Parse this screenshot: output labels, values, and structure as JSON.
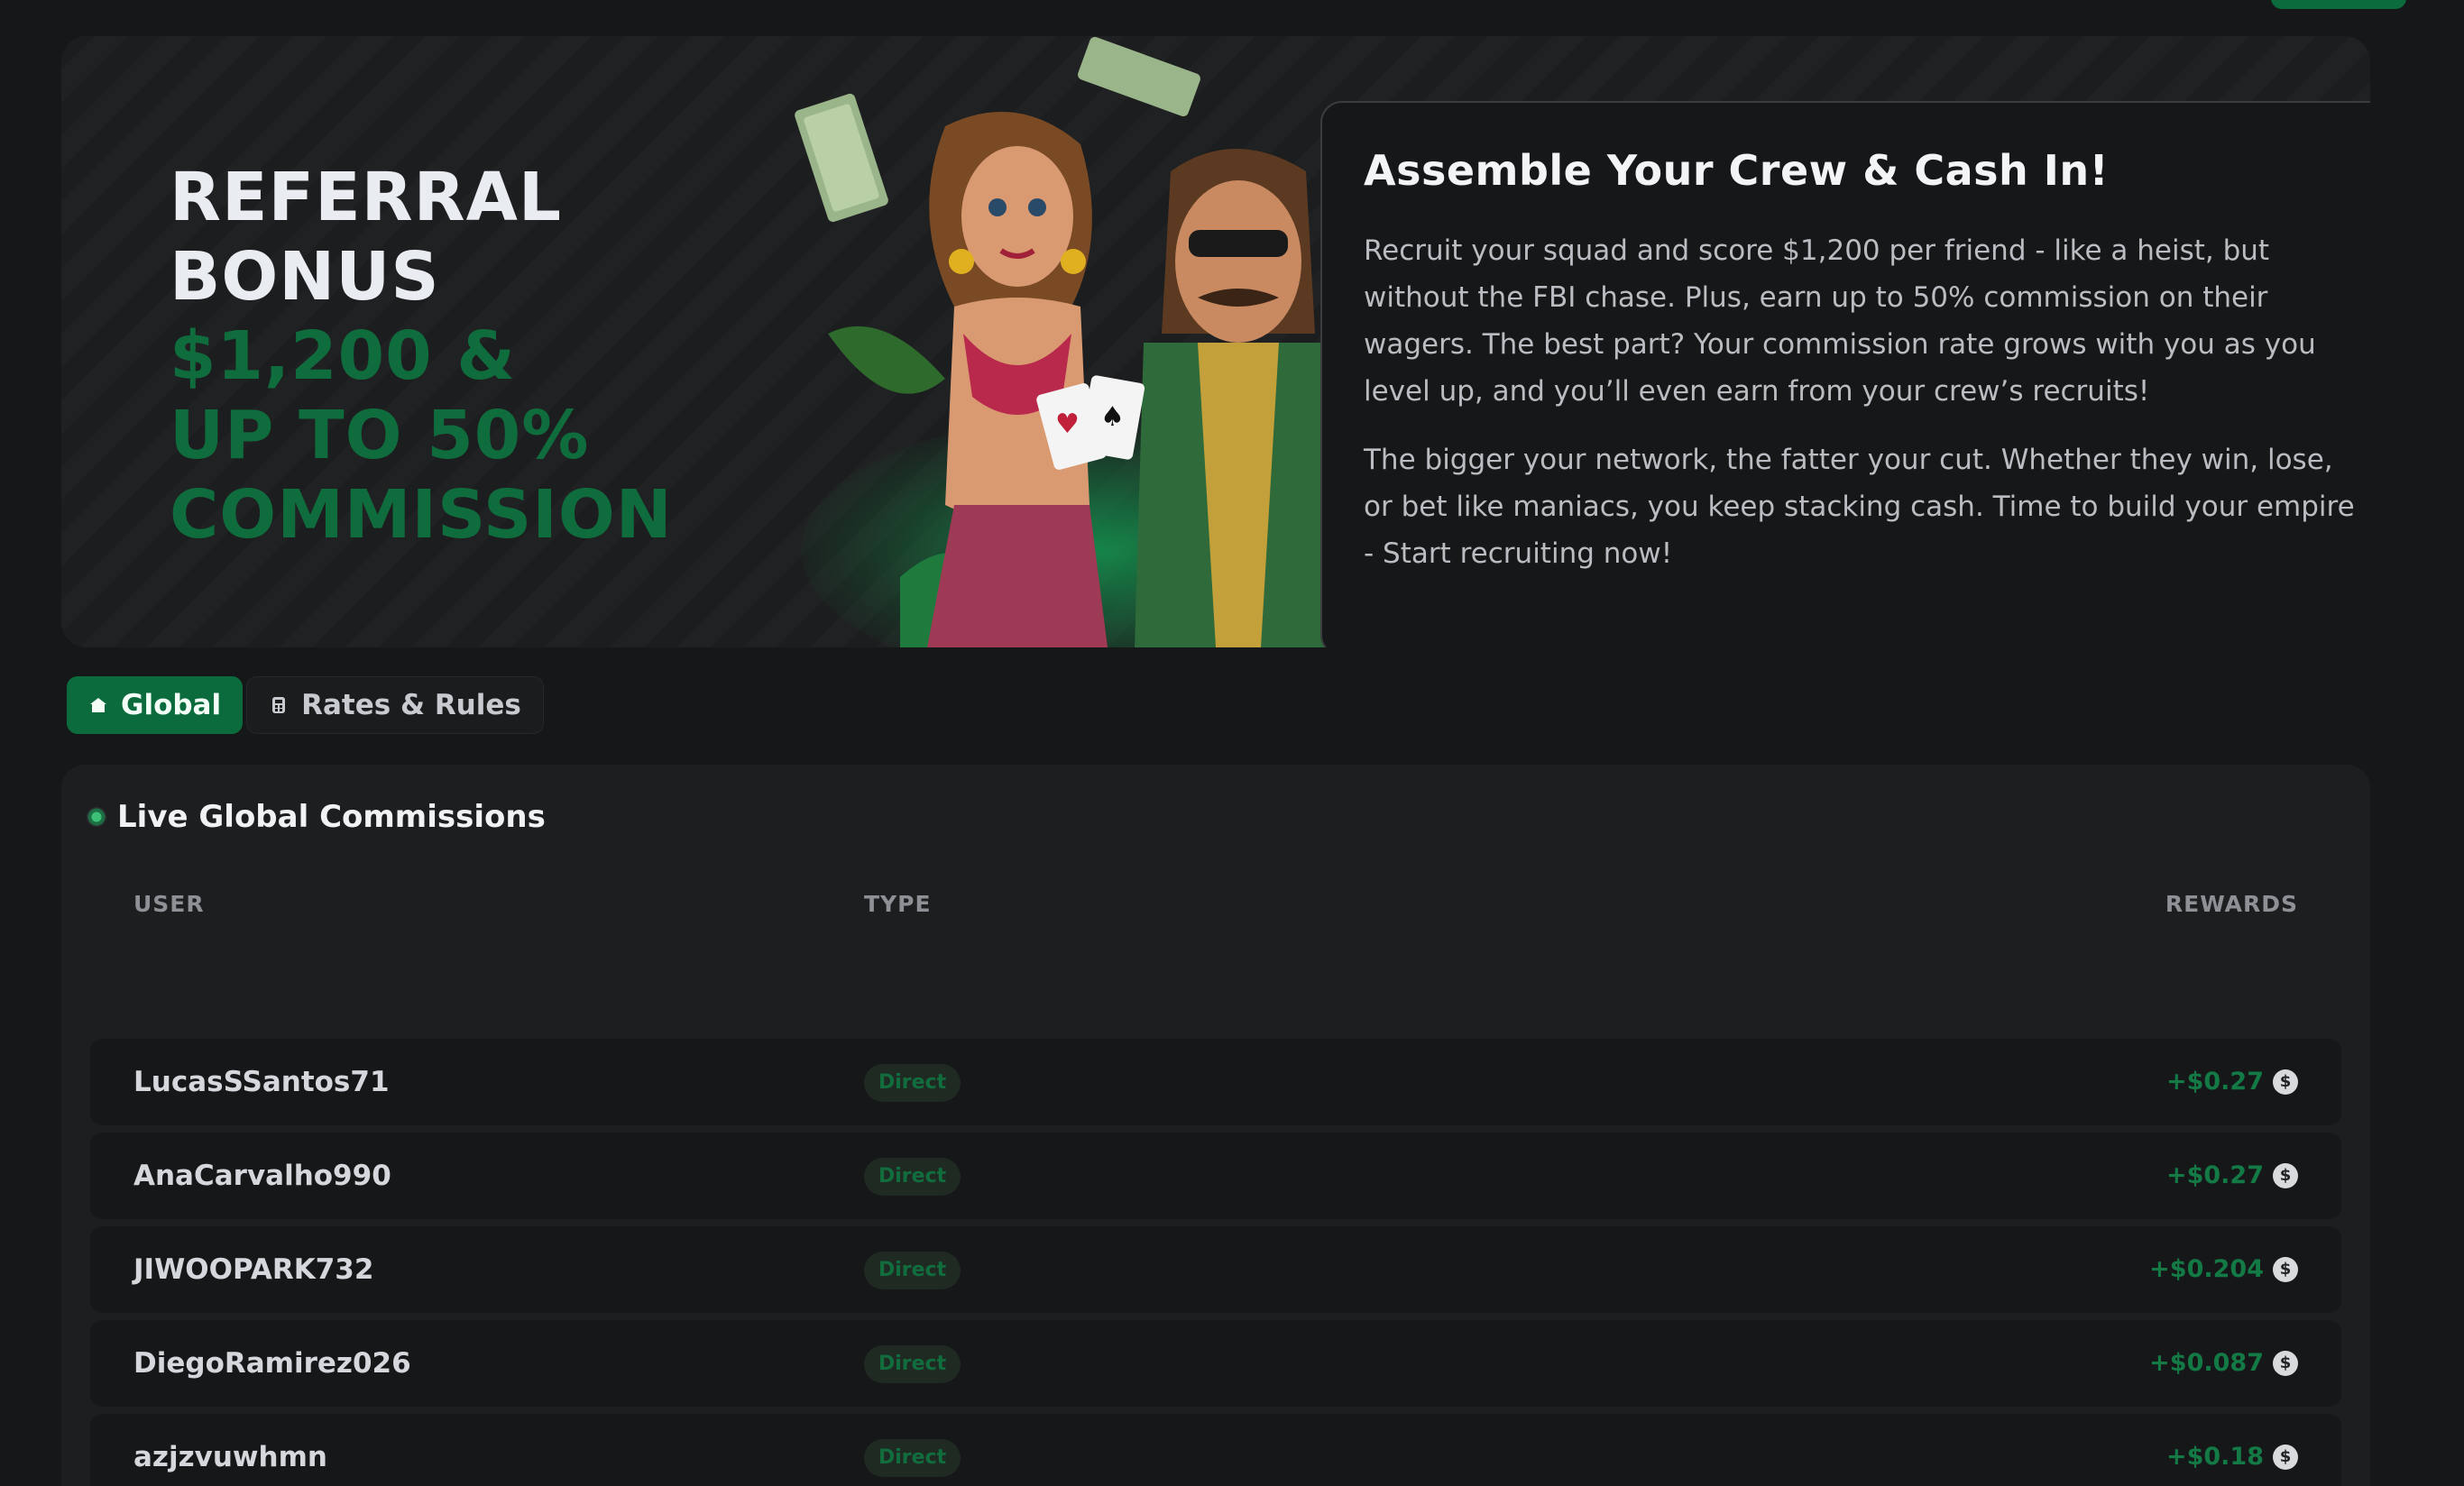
{
  "hero": {
    "title_lines": [
      "REFERRAL",
      "BONUS"
    ],
    "highlight_lines": [
      "$1,200 &",
      "UP TO 50%",
      "COMMISSION"
    ],
    "card_title": "Assemble Your Crew & Cash In!",
    "card_paragraphs": [
      "Recruit your squad and score $1,200 per friend - like a heist, but without the FBI chase. Plus, earn up to 50% commission on their wagers. The best part? Your commission rate grows with you as you level up, and you’ll even earn from your crew’s recruits!",
      "The bigger your network, the fatter your cut. Whether they win, lose, or bet like maniacs, you keep stacking cash. Time to build your empire - Start recruiting now!"
    ]
  },
  "tabs": [
    {
      "label": "Global",
      "icon": "home-icon",
      "active": true
    },
    {
      "label": "Rates & Rules",
      "icon": "calculator-icon",
      "active": false
    }
  ],
  "commissions": {
    "title": "Live Global Commissions",
    "columns": {
      "user": "USER",
      "type": "TYPE",
      "rewards": "REWARDS"
    },
    "rows": [
      {
        "user": "LucasSSantos71",
        "type": "Direct",
        "reward": "+$0.27"
      },
      {
        "user": "AnaCarvalho990",
        "type": "Direct",
        "reward": "+$0.27"
      },
      {
        "user": "JIWOOPARK732",
        "type": "Direct",
        "reward": "+$0.204"
      },
      {
        "user": "DiegoRamirez026",
        "type": "Direct",
        "reward": "+$0.087"
      },
      {
        "user": "azjzvuwhmn",
        "type": "Direct",
        "reward": "+$0.18"
      }
    ],
    "coin_symbol": "$"
  },
  "colors": {
    "accent": "#0c6b3c",
    "background": "#161718",
    "panel": "#1d1e20",
    "reward_green": "#137a45"
  }
}
